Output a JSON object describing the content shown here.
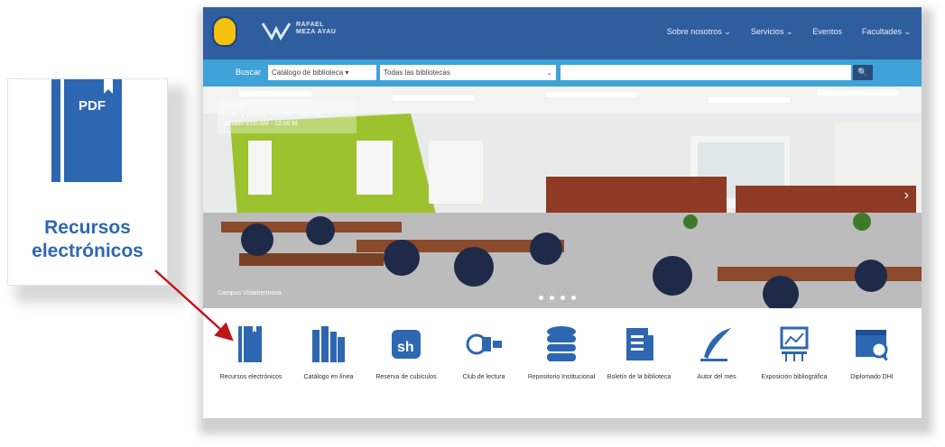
{
  "callout": {
    "icon": "pdf-document-icon",
    "badge": "PDF",
    "line1": "Recursos",
    "line2": "electrónicos",
    "color": "#2e67b1"
  },
  "arrow_color": "#c0141b",
  "site": {
    "logo_line1": "RAFAEL",
    "logo_line2": "MEZA AYAU",
    "nav": [
      "Sobre nosotros ⌄",
      "Servicios ⌄",
      "Eventos",
      "Facultades ⌄"
    ],
    "search": {
      "label": "Buscar",
      "scope": "Catálogo de biblioteca ▾",
      "library": "Todas las bibliotecas",
      "query": "",
      "button_icon": "search-icon"
    },
    "hero": {
      "overlay_line1": "Horarios",
      "overlay_line2": "Lunes a viernes 7:00 AM - 9:00 PM",
      "overlay_line3": "Sábado 8:00 AM - 12:00 M",
      "caption": "Campus Vistahermosa",
      "next": "›",
      "slides": 4
    },
    "icons": [
      {
        "label": "Recursos electrónicos",
        "icon": "ebook-icon"
      },
      {
        "label": "Catálogo en línea",
        "icon": "books-icon"
      },
      {
        "label": "Reserva de cubículos",
        "icon": "cubicle-icon"
      },
      {
        "label": "Club de lectura",
        "icon": "reading-club-icon"
      },
      {
        "label": "Repositorio Institucional",
        "icon": "database-icon"
      },
      {
        "label": "Boletín de la biblioteca",
        "icon": "newsletter-icon"
      },
      {
        "label": "Autor del mes",
        "icon": "quill-icon"
      },
      {
        "label": "Exposición bibliográfica",
        "icon": "exhibit-icon"
      },
      {
        "label": "Diplomado DHI",
        "icon": "diploma-icon"
      }
    ],
    "colors": {
      "topbar": "#2f5e9f",
      "searchbar": "#3fa3d8",
      "icon_blue": "#2e67b1"
    }
  }
}
